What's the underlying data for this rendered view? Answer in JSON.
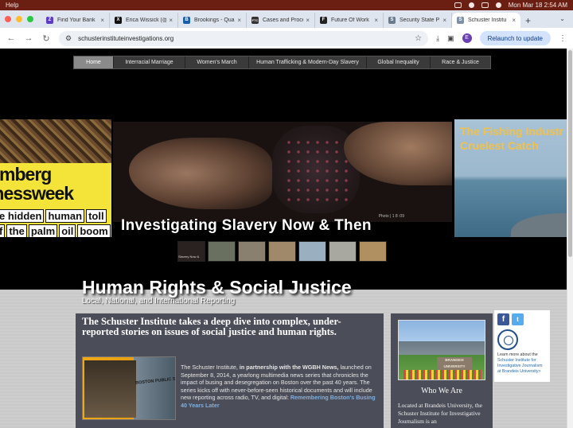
{
  "menubar": {
    "app_menu": "Help",
    "clock": "Mon Mar 18  2:54 AM"
  },
  "browser": {
    "tabs": [
      {
        "label": "Find Your Bank",
        "favicon": "Z",
        "color": "#5b3cc4"
      },
      {
        "label": "Erica Wissick (@",
        "favicon": "X",
        "color": "#111111"
      },
      {
        "label": "Brookings - Qua",
        "favicon": "B",
        "color": "#1a5ea8"
      },
      {
        "label": "Cases and Proce",
        "favicon": "FTC",
        "color": "#333333"
      },
      {
        "label": "Future Of Work",
        "favicon": "F",
        "color": "#222222"
      },
      {
        "label": "Security State P",
        "favicon": "S",
        "color": "#6b7b8c"
      },
      {
        "label": "Schuster Institu",
        "favicon": "S",
        "color": "#7f8fa6",
        "active": true
      }
    ],
    "new_tab": "+",
    "url": "schusterinstituteinvestigations.org",
    "avatar_letter": "E",
    "relaunch_label": "Relaunch to update"
  },
  "site": {
    "nav": [
      {
        "label": "Home",
        "active": true
      },
      {
        "label": "Interracial Marriage"
      },
      {
        "label": "Women's March"
      },
      {
        "label": "Human Trafficking & Modern-Day Slavery"
      },
      {
        "label": "Global Inequality"
      },
      {
        "label": "Race & Justice"
      }
    ],
    "slider": {
      "left": {
        "line1": "omberg",
        "line2": "inessweek",
        "words_row1": [
          "e hidden",
          "human",
          "toll"
        ],
        "words_row2": [
          "f",
          "the",
          "palm",
          "oil",
          "boom"
        ]
      },
      "main_title": "Investigating Slavery Now & Then",
      "main_credit": "Photo | 1 8 :09",
      "right_title_line1": "The Fishing Industr",
      "right_title_line2": "Cruelest Catch",
      "thumb_caption": "Slavery Now &",
      "thumbs": [
        "#2a2220",
        "#6a7060",
        "#8a8070",
        "#a0886a",
        "#9ab0c0",
        "#a8a8a0",
        "#b09060"
      ]
    },
    "hero_title": "Human Rights & Social Justice",
    "hero_subtitle": "Local, National, and International Reporting",
    "intro_heading": "The Schuster Institute takes a deep dive into complex, under-reported stories on issues of social justice and human rights.",
    "bus_sign": "BOSTON PUBLIC SCHOOLS",
    "article": {
      "p1": "The Schuster Institute,",
      "bold1": "in partnership with the",
      "bold2": "WGBH News,",
      "p2": "launched on September 8, 2014, a yearlong multimedia news series that chronicles the impact of busing and desegregation on Boston over the past 40 years. The series kicks off with never-before-seen historical documents and will include new reporting across radio, TV, and digital:",
      "link": "Remembering Boston's Busing 40 Years Later"
    },
    "campus_sign": "BRANDEIS UNIVERSITY",
    "who_we_are_heading": "Who We Are",
    "who_we_are_text": "Located at Brandeis University, the Schuster Institute for Investigative Journalism is an",
    "social": {
      "text1": "Learn more about the",
      "link": "Schuster Institute for Investigative Journalism at Brandeis University>"
    }
  },
  "colors": {
    "desktop": "#7a2418",
    "page_panel": "#4b4d58",
    "accent_link": "#7fb0e0",
    "yellow": "#f4e43a"
  }
}
